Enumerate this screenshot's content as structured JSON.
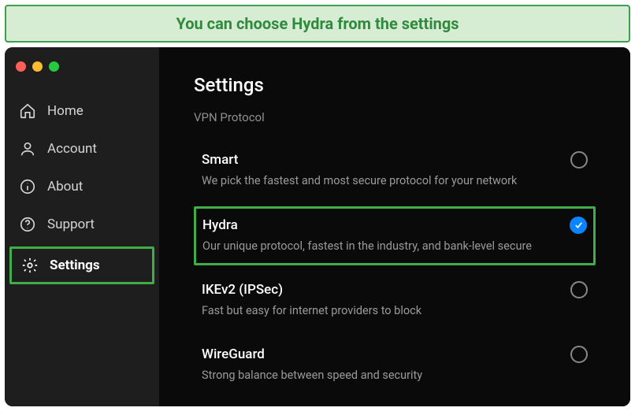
{
  "banner": {
    "text": "You can choose Hydra from the settings"
  },
  "sidebar": {
    "items": [
      {
        "label": "Home"
      },
      {
        "label": "Account"
      },
      {
        "label": "About"
      },
      {
        "label": "Support"
      },
      {
        "label": "Settings"
      }
    ]
  },
  "content": {
    "title": "Settings",
    "section": "VPN Protocol"
  },
  "protocols": [
    {
      "name": "Smart",
      "desc": "We pick the fastest and most secure protocol for your network",
      "selected": false
    },
    {
      "name": "Hydra",
      "desc": "Our unique protocol, fastest in the industry, and bank-level secure",
      "selected": true
    },
    {
      "name": "IKEv2 (IPSec)",
      "desc": "Fast but easy for internet providers to block",
      "selected": false
    },
    {
      "name": "WireGuard",
      "desc": "Strong balance between speed and security",
      "selected": false
    }
  ],
  "colors": {
    "accent": "#3fae46",
    "check": "#0a84ff"
  }
}
